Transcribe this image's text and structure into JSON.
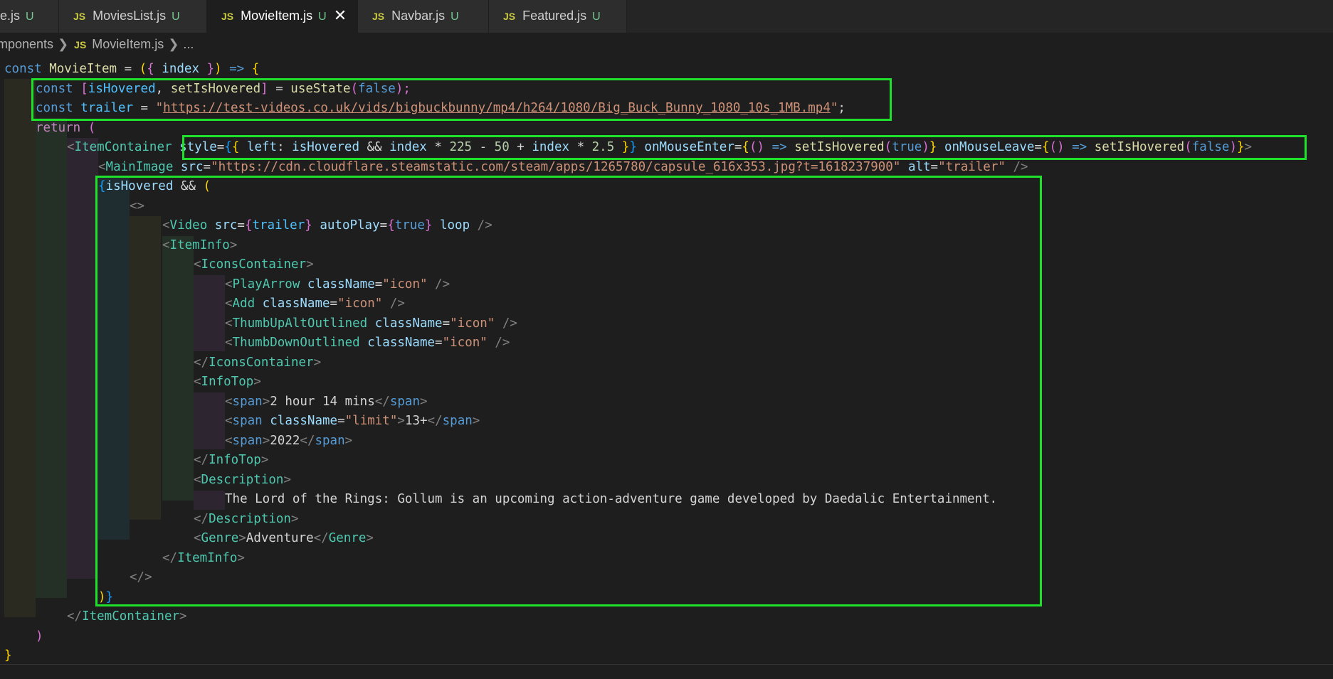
{
  "tabs": [
    {
      "name": "e.js",
      "status": "U",
      "active": false
    },
    {
      "name": "MoviesList.js",
      "status": "U",
      "active": false
    },
    {
      "name": "MovieItem.js",
      "status": "U",
      "active": true,
      "close": "✕"
    },
    {
      "name": "Navbar.js",
      "status": "U",
      "active": false
    },
    {
      "name": "Featured.js",
      "status": "U",
      "active": false
    }
  ],
  "file_badge": "JS",
  "breadcrumb": {
    "folder": "mponents",
    "file": "MovieItem.js",
    "more": "..."
  },
  "code": {
    "l1": [
      "const",
      "MovieItem",
      " = ",
      "(",
      "{ ",
      "index",
      " }",
      ")",
      " => ",
      "{"
    ],
    "l2": [
      "const",
      " ",
      "[",
      "isHovered",
      ", ",
      "setIsHovered",
      "]",
      " = ",
      "useState",
      "(",
      "false",
      ");"
    ],
    "l3": [
      "const",
      " ",
      "trailer",
      " = ",
      "\"",
      "https://test-videos.co.uk/vids/bigbuckbunny/mp4/h264/1080/Big_Buck_Bunny_1080_10s_1MB.mp4",
      "\"",
      ";"
    ],
    "l4": [
      "return",
      " ",
      "("
    ],
    "l5": [
      "<",
      "ItemContainer",
      " ",
      "style",
      "=",
      "{",
      "{ ",
      "left",
      ": ",
      "isHovered",
      " && ",
      "index",
      " * ",
      "225",
      " - ",
      "50",
      " + ",
      "index",
      " * ",
      "2.5",
      " }",
      "}",
      " ",
      "onMouseEnter",
      "=",
      "{",
      "(",
      ")",
      " => ",
      "setIsHovered",
      "(",
      "true",
      ")",
      "}",
      " ",
      "onMouseLeave",
      "=",
      "{",
      "(",
      ")",
      " => ",
      "setIsHovered",
      "(",
      "false",
      ")",
      "}",
      ">"
    ],
    "l6": [
      "<",
      "MainImage",
      " ",
      "src",
      "=",
      "\"https://cdn.cloudflare.steamstatic.com/steam/apps/1265780/capsule_616x353.jpg?t=1618237900\"",
      " ",
      "alt",
      "=",
      "\"trailer\"",
      " />"
    ],
    "l7": [
      "{",
      "isHovered",
      " && ",
      "("
    ],
    "l8": [
      "<>"
    ],
    "l9": [
      "<",
      "Video",
      " ",
      "src",
      "=",
      "{",
      "trailer",
      "}",
      " ",
      "autoPlay",
      "=",
      "{",
      "true",
      "}",
      " ",
      "loop",
      " />"
    ],
    "l10": [
      "<",
      "ItemInfo",
      ">"
    ],
    "l11": [
      "<",
      "IconsContainer",
      ">"
    ],
    "l12": [
      "<",
      "PlayArrow",
      " ",
      "className",
      "=",
      "\"icon\"",
      " />"
    ],
    "l13": [
      "<",
      "Add",
      " ",
      "className",
      "=",
      "\"icon\"",
      " />"
    ],
    "l14": [
      "<",
      "ThumbUpAltOutlined",
      " ",
      "className",
      "=",
      "\"icon\"",
      " />"
    ],
    "l15": [
      "<",
      "ThumbDownOutlined",
      " ",
      "className",
      "=",
      "\"icon\"",
      " />"
    ],
    "l16": [
      "</",
      "IconsContainer",
      ">"
    ],
    "l17": [
      "<",
      "InfoTop",
      ">"
    ],
    "l18": [
      "<",
      "span",
      ">",
      "2 hour 14 mins",
      "</",
      "span",
      ">"
    ],
    "l19": [
      "<",
      "span",
      " ",
      "className",
      "=",
      "\"limit\"",
      ">",
      "13+",
      "</",
      "span",
      ">"
    ],
    "l20": [
      "<",
      "span",
      ">",
      "2022",
      "</",
      "span",
      ">"
    ],
    "l21": [
      "</",
      "InfoTop",
      ">"
    ],
    "l22": [
      "<",
      "Description",
      ">"
    ],
    "l23": [
      "The Lord of the Rings: Gollum is an upcoming action-adventure game developed by Daedalic Entertainment."
    ],
    "l24": [
      "</",
      "Description",
      ">"
    ],
    "l25": [
      "<",
      "Genre",
      ">",
      "Adventure",
      "</",
      "Genre",
      ">"
    ],
    "l26": [
      "</",
      "ItemInfo",
      ">"
    ],
    "l27": [
      "</>"
    ],
    "l28": [
      ")",
      "}"
    ],
    "l29": [
      "</",
      "ItemContainer",
      ">"
    ],
    "l30": [
      ")"
    ],
    "l31": [
      "}"
    ]
  },
  "colors": {
    "highlight_box": "#1fe02a",
    "background": "#1e1e1e",
    "tab_bar": "#252526"
  }
}
